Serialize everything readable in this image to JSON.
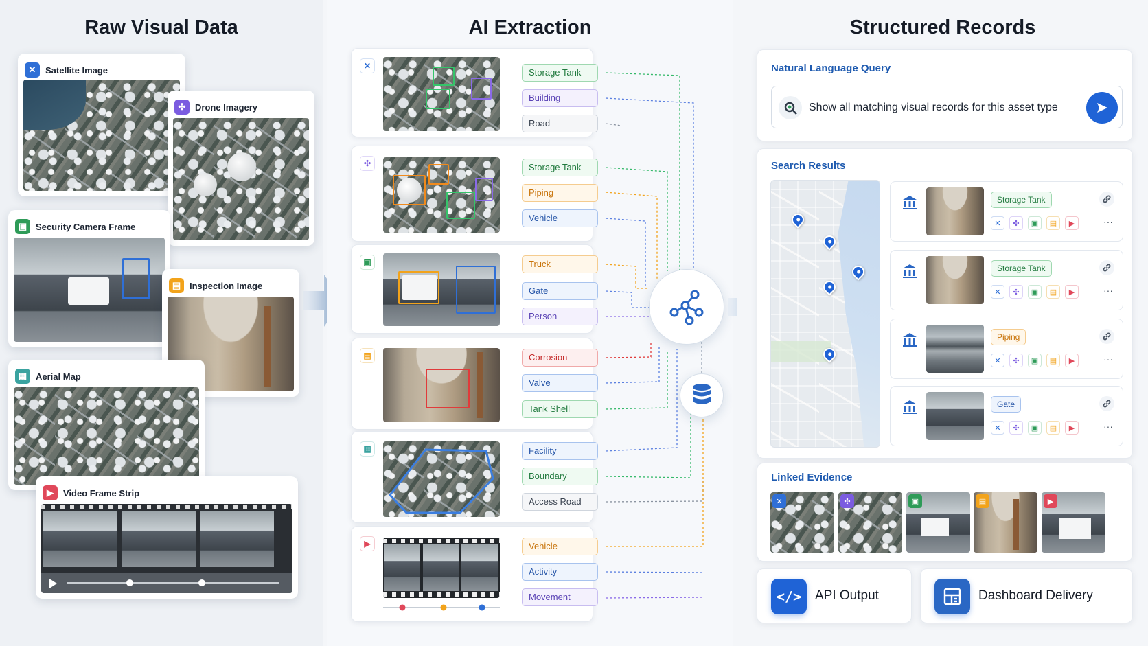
{
  "columns": {
    "raw_title": "Raw Visual Data",
    "ai_title": "AI Extraction",
    "records_title": "Structured Records"
  },
  "raw_sources": {
    "satellite": "Satellite Image",
    "drone": "Drone Imagery",
    "security": "Security Camera Frame",
    "inspection": "Inspection Image",
    "aerial": "Aerial Map",
    "video": "Video Frame Strip"
  },
  "extraction_tags": {
    "satellite": [
      "Storage Tank",
      "Building",
      "Road"
    ],
    "drone": [
      "Storage Tank",
      "Piping",
      "Vehicle"
    ],
    "security": [
      "Truck",
      "Gate",
      "Person"
    ],
    "inspection": [
      "Corrosion",
      "Valve",
      "Tank Shell"
    ],
    "aerial": [
      "Facility",
      "Boundary",
      "Access Road"
    ],
    "video": [
      "Vehicle",
      "Activity",
      "Movement"
    ]
  },
  "query": {
    "label": "Natural Language Query",
    "text": "Show all matching visual records for this asset type"
  },
  "results": {
    "label": "Search Results",
    "items": [
      {
        "tag": "Storage Tank",
        "color": "green"
      },
      {
        "tag": "Storage Tank",
        "color": "green"
      },
      {
        "tag": "Piping",
        "color": "orange"
      },
      {
        "tag": "Gate",
        "color": "blue"
      }
    ],
    "more_glyph": "···"
  },
  "evidence": {
    "label": "Linked Evidence"
  },
  "outputs": {
    "api": "API Output",
    "dashboard": "Dashboard Delivery"
  },
  "colors": {
    "satellite": "#2f6fd6",
    "drone": "#7b5ce0",
    "security": "#2e9b58",
    "inspection": "#f2a31b",
    "aerial": "#3aa3a0",
    "video": "#e0485a",
    "accent": "#1f63d6"
  },
  "icons": {
    "satellite": "satellite-icon",
    "drone": "drone-icon",
    "security": "camera-icon",
    "inspection": "clipboard-icon",
    "aerial": "map-icon",
    "video": "video-icon",
    "hub": "network-graph-icon",
    "database": "database-icon",
    "send": "send-icon",
    "asset": "building-icon",
    "link": "link-icon",
    "code": "code-icon",
    "dashboard": "dashboard-icon"
  }
}
